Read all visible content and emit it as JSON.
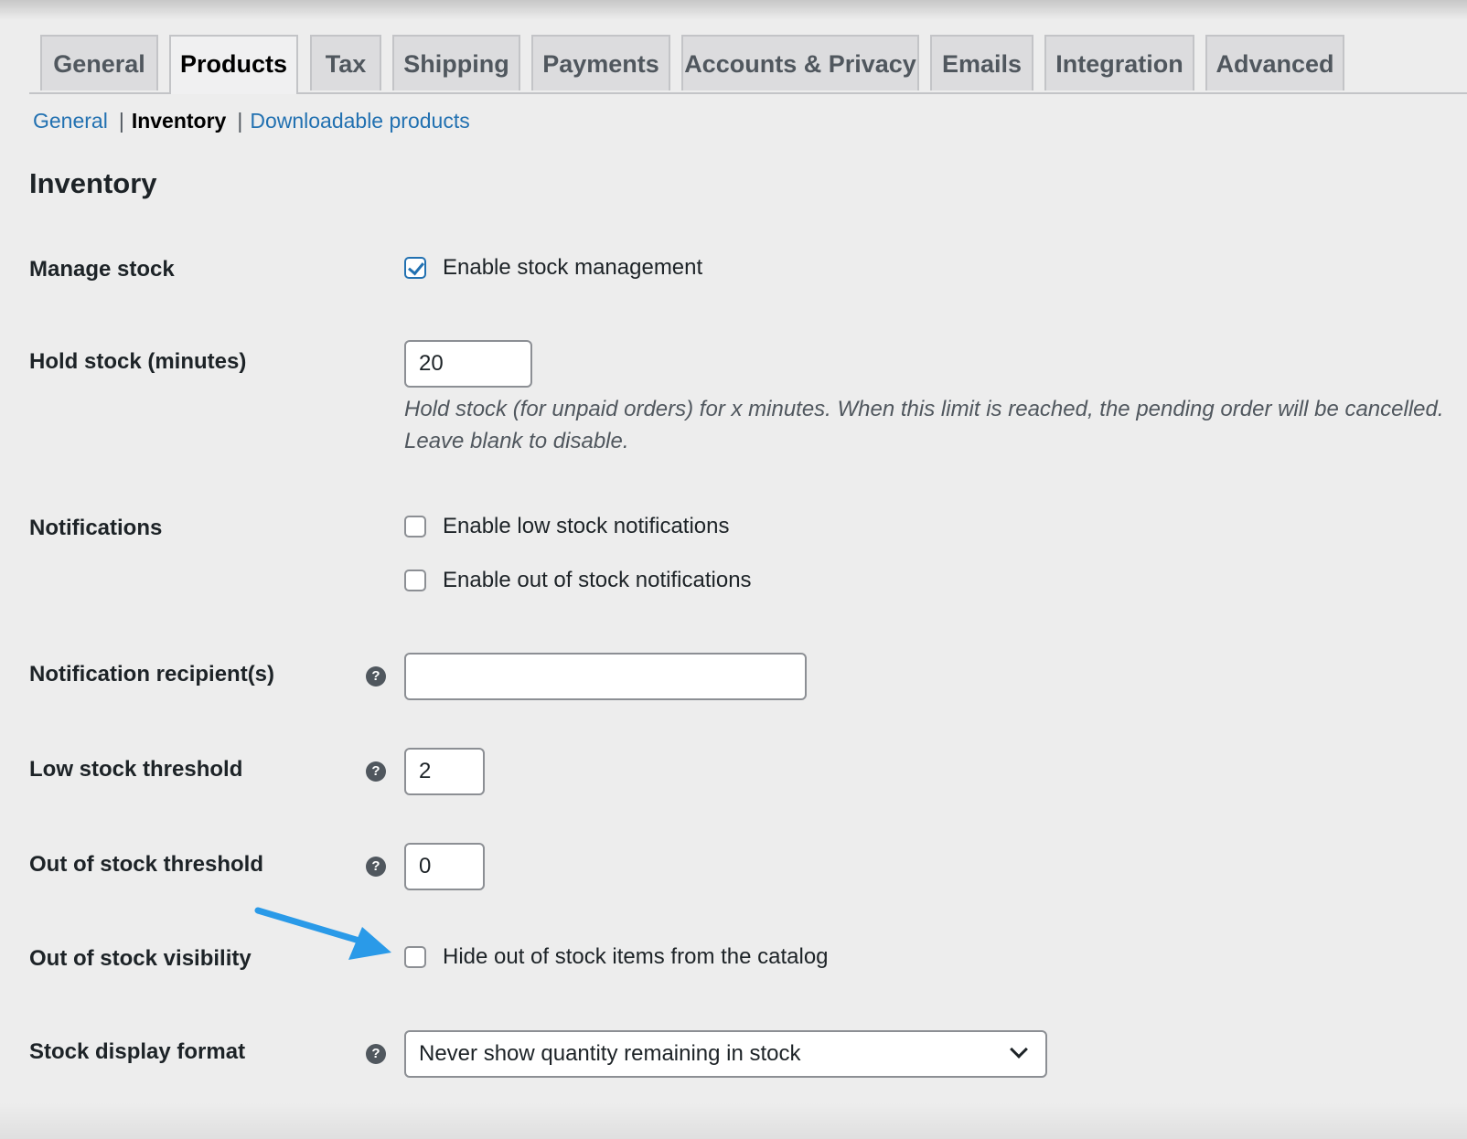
{
  "tabs": [
    {
      "label": "General",
      "active": false
    },
    {
      "label": "Products",
      "active": true
    },
    {
      "label": "Tax",
      "active": false
    },
    {
      "label": "Shipping",
      "active": false
    },
    {
      "label": "Payments",
      "active": false
    },
    {
      "label": "Accounts & Privacy",
      "active": false
    },
    {
      "label": "Emails",
      "active": false
    },
    {
      "label": "Integration",
      "active": false
    },
    {
      "label": "Advanced",
      "active": false
    }
  ],
  "subnav": {
    "items": [
      {
        "label": "General",
        "current": false
      },
      {
        "label": "Inventory",
        "current": true
      },
      {
        "label": "Downloadable products",
        "current": false
      }
    ],
    "separator": "|"
  },
  "section_title": "Inventory",
  "help_icon_glyph": "?",
  "fields": {
    "manage_stock": {
      "label": "Manage stock",
      "checkbox_label": "Enable stock management",
      "checked": true
    },
    "hold_stock": {
      "label": "Hold stock (minutes)",
      "value": "20",
      "description": "Hold stock (for unpaid orders) for x minutes. When this limit is reached, the pending order will be cancelled. Leave blank to disable."
    },
    "notifications": {
      "label": "Notifications",
      "low_stock_label": "Enable low stock notifications",
      "low_stock_checked": false,
      "out_of_stock_label": "Enable out of stock notifications",
      "out_of_stock_checked": false
    },
    "notification_recipients": {
      "label": "Notification recipient(s)",
      "value": ""
    },
    "low_stock_threshold": {
      "label": "Low stock threshold",
      "value": "2"
    },
    "out_of_stock_threshold": {
      "label": "Out of stock threshold",
      "value": "0"
    },
    "out_of_stock_visibility": {
      "label": "Out of stock visibility",
      "checkbox_label": "Hide out of stock items from the catalog",
      "checked": false
    },
    "stock_display_format": {
      "label": "Stock display format",
      "selected": "Never show quantity remaining in stock"
    }
  },
  "colors": {
    "background": "#ededed",
    "link": "#2271b1",
    "annotation_arrow": "#2a9ae8",
    "checkbox_accent": "#2271b1"
  },
  "icons": {
    "help": "help-icon",
    "checkmark": "checkmark-icon",
    "select_chevron": "chevron-down-icon",
    "annotation": "arrow-annotation-icon"
  }
}
